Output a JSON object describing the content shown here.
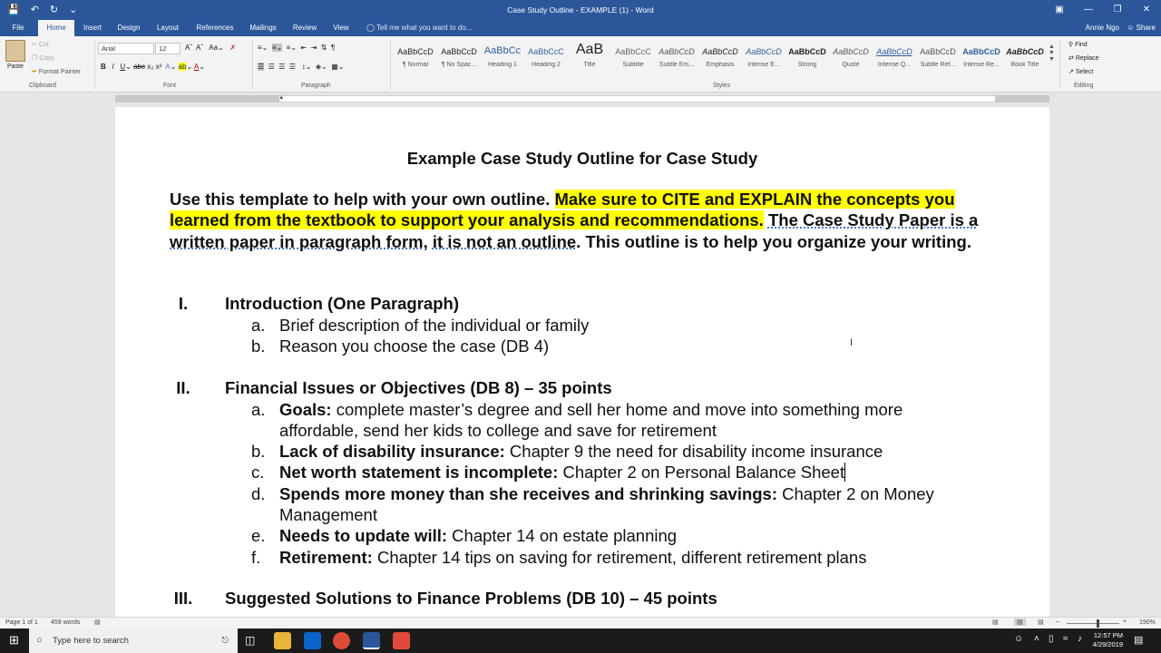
{
  "window": {
    "title": "Case Study Outline - EXAMPLE (1) - Word"
  },
  "tabs": [
    "File",
    "Home",
    "Insert",
    "Design",
    "Layout",
    "References",
    "Mailings",
    "Review",
    "View"
  ],
  "tell_me": "Tell me what you want to do...",
  "user": {
    "name": "Annie Ngo",
    "share": "Share"
  },
  "ribbon": {
    "clipboard": {
      "paste": "Paste",
      "cut": "Cut",
      "copy": "Copy",
      "format_painter": "Format Painter",
      "label": "Clipboard"
    },
    "font": {
      "name": "Arial",
      "size": "12",
      "label": "Font"
    },
    "paragraph": {
      "label": "Paragraph"
    },
    "styles": {
      "label": "Styles",
      "items": [
        {
          "preview": "AaBbCcD",
          "name": "¶ Normal"
        },
        {
          "preview": "AaBbCcD",
          "name": "¶ No Spac..."
        },
        {
          "preview": "AaBbCc",
          "name": "Heading 1"
        },
        {
          "preview": "AaBbCcC",
          "name": "Heading 2"
        },
        {
          "preview": "AaB",
          "name": "Title"
        },
        {
          "preview": "AaBbCcC",
          "name": "Subtitle"
        },
        {
          "preview": "AaBbCcD",
          "name": "Subtle Em..."
        },
        {
          "preview": "AaBbCcD",
          "name": "Emphasis"
        },
        {
          "preview": "AaBbCcD",
          "name": "Intense E..."
        },
        {
          "preview": "AaBbCcD",
          "name": "Strong"
        },
        {
          "preview": "AaBbCcD",
          "name": "Quote"
        },
        {
          "preview": "AaBbCcD",
          "name": "Intense Q..."
        },
        {
          "preview": "AaBbCcD",
          "name": "Subtle Ref..."
        },
        {
          "preview": "AaBbCcD",
          "name": "Intense Re..."
        },
        {
          "preview": "AaBbCcD",
          "name": "Book Title"
        }
      ]
    },
    "editing": {
      "find": "Find",
      "replace": "Replace",
      "select": "Select",
      "label": "Editing"
    }
  },
  "document": {
    "title": "Example Case Study Outline for Case Study",
    "intro_plain": "Use this template to help with your own outline. ",
    "intro_highlight": "Make sure to CITE and EXPLAIN the concepts you learned from the textbook to support your analysis and recommendations.",
    "intro_ul1": "The Case Study Paper is a written paper in paragraph form",
    "intro_comma": ", ",
    "intro_ul2": "it is not an outline",
    "intro_end": ". This outline is to help you organize your writing.",
    "sections": [
      {
        "num": "I.",
        "title": "Introduction (One Paragraph)",
        "items": [
          {
            "letter": "a.",
            "bold": "",
            "text": "Brief description of the individual or family"
          },
          {
            "letter": "b.",
            "bold": "",
            "text": "Reason you choose the case (DB 4)"
          }
        ]
      },
      {
        "num": "II.",
        "title": "Financial Issues or Objectives (DB 8) – 35 points",
        "items": [
          {
            "letter": "a.",
            "bold": "Goals:",
            "text": " complete master’s degree and sell her home and move into something more affordable, send her kids to college and save for retirement"
          },
          {
            "letter": "b.",
            "bold": "Lack of disability insurance:",
            "text": " Chapter 9 the need for disability income insurance"
          },
          {
            "letter": "c.",
            "bold": "Net worth statement is incomplete:",
            "text": " Chapter 2 on Personal Balance Sheet"
          },
          {
            "letter": "d.",
            "bold": "Spends more money than she receives and shrinking savings:",
            "text": " Chapter 2 on Money Management"
          },
          {
            "letter": "e.",
            "bold": "Needs to update will:",
            "text": " Chapter 14 on estate planning"
          },
          {
            "letter": "f.",
            "bold": "Retirement:",
            "text": " Chapter 14 tips on saving for retirement, different retirement plans"
          }
        ]
      },
      {
        "num": "III.",
        "title": "Suggested Solutions to Finance Problems (DB 10) – 45 points",
        "items": []
      }
    ]
  },
  "status": {
    "page": "Page 1 of 1",
    "words": "459 words",
    "zoom": "190%"
  },
  "taskbar": {
    "search_placeholder": "Type here to search",
    "time": "12:57 PM",
    "date": "4/29/2019"
  },
  "colors": {
    "word_blue": "#2b579a",
    "highlight": "#ffff00"
  }
}
